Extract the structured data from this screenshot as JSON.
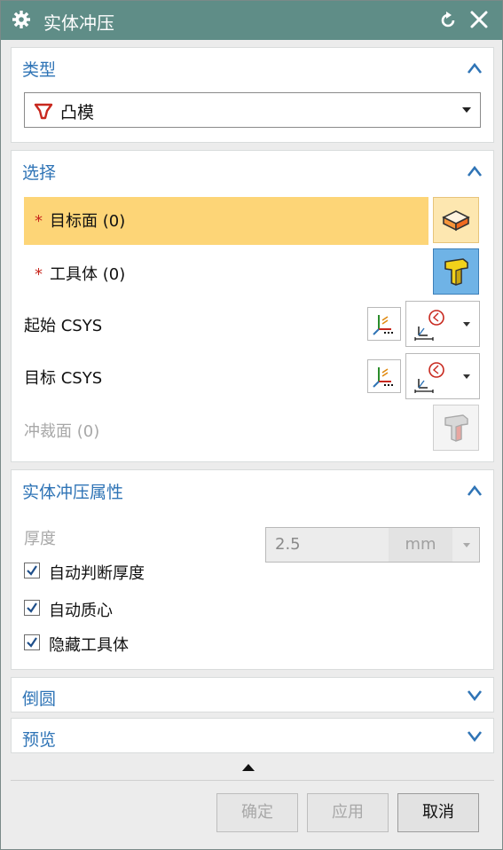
{
  "window": {
    "title": "实体冲压"
  },
  "sections": {
    "type": {
      "title": "类型",
      "selected": "凸模"
    },
    "selection": {
      "title": "选择",
      "target_face": "目标面 (0)",
      "tool_body": "工具体 (0)",
      "start_csys": "起始 CSYS",
      "target_csys": "目标 CSYS",
      "punch_face": "冲裁面 (0)",
      "required_mark": "*"
    },
    "properties": {
      "title": "实体冲压属性",
      "thickness_label": "厚度",
      "thickness_value": "2.5",
      "thickness_unit": "mm",
      "checkboxes": [
        {
          "label": "自动判断厚度",
          "checked": true
        },
        {
          "label": "自动质心",
          "checked": true
        },
        {
          "label": "隐藏工具体",
          "checked": true
        }
      ]
    },
    "fillet": {
      "title": "倒圆"
    },
    "preview": {
      "title": "预览"
    }
  },
  "buttons": {
    "ok": "确定",
    "apply": "应用",
    "cancel": "取消"
  },
  "colors": {
    "titlebar": "#5f8d87",
    "section_title": "#2f74b6",
    "highlight": "#fdd577",
    "required": "#c8281e",
    "active_button": "#6fb3e6"
  }
}
